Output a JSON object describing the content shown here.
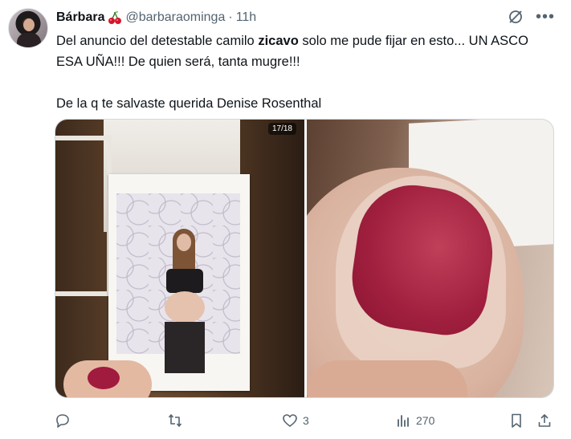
{
  "author": {
    "display_name": "Bárbara",
    "handle": "@barbaraominga",
    "separator": "·",
    "time": "11h"
  },
  "tweet": {
    "line1_prefix": "Del anuncio del detestable camilo ",
    "line1_bold": "zicavo",
    "line1_suffix": " solo me pude fijar en esto... UN ASCO ESA UÑA!!! De quien será, tanta mugre!!!",
    "line2": "De la q te salvaste querida Denise Rosenthal"
  },
  "media": {
    "counter": "17/18"
  },
  "actions": {
    "reply_count": "",
    "retweet_count": "",
    "like_count": "3",
    "views_count": "270"
  },
  "colors": {
    "text": "#0f1419",
    "muted": "#536471",
    "border": "#cfd9de"
  },
  "icons": [
    "cherry-icon",
    "grok-icon",
    "more-icon",
    "reply-icon",
    "retweet-icon",
    "like-icon",
    "views-icon",
    "bookmark-icon",
    "share-icon"
  ]
}
